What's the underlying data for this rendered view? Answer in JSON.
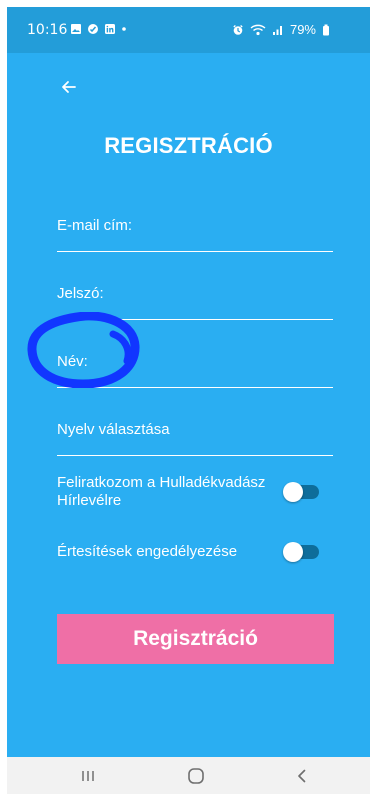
{
  "status_bar": {
    "time": "10:16",
    "battery": "79%"
  },
  "screen": {
    "title": "REGISZTRÁCIÓ",
    "fields": {
      "email_label": "E-mail cím:",
      "password_label": "Jelszó:",
      "name_label": "Név:",
      "language_label": "Nyelv választása"
    },
    "toggles": {
      "newsletter_label": "Feliratkozom a Hulladékvadász Hírlevélre",
      "notifications_label": "Értesítések engedélyezése"
    },
    "register_button_label": "Regisztráció"
  },
  "colors": {
    "background": "#2aaef2",
    "status_bar": "#239dd9",
    "button": "#ef6fa6",
    "annotation": "#1136ff",
    "toggle_track": "#0e6d9b",
    "navbar": "#f2f2f2"
  },
  "icons": {
    "back": "arrow-left-icon",
    "recent_apps": "recent-apps-icon",
    "home": "home-icon",
    "system_back": "chevron-left-icon"
  }
}
